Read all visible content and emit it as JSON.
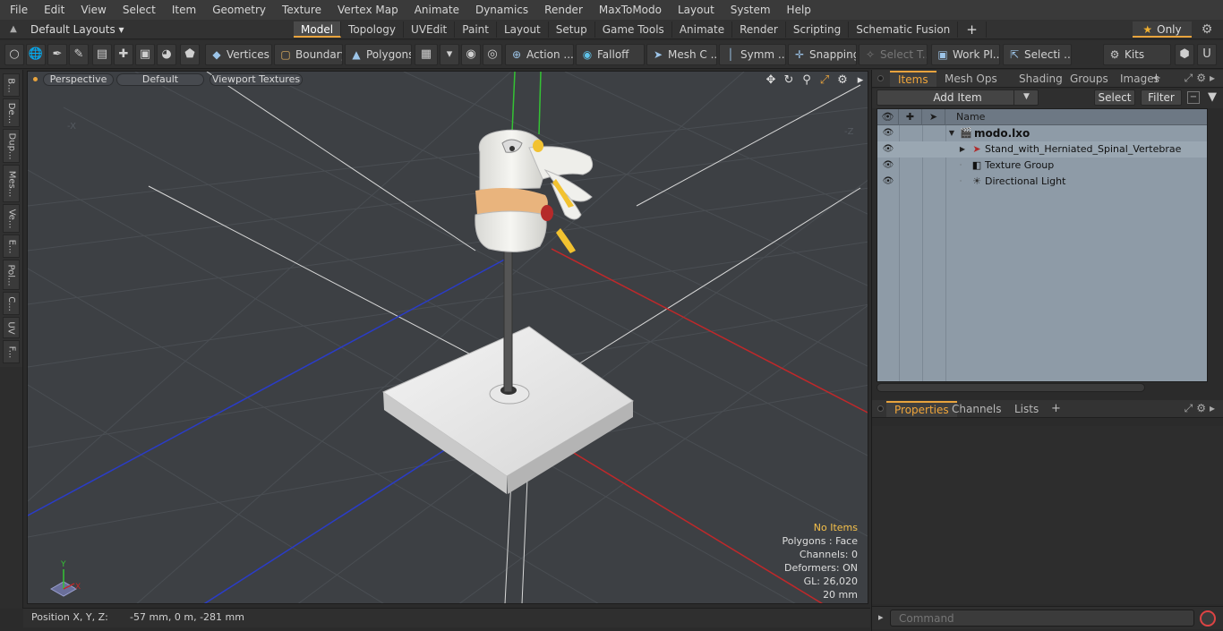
{
  "menu": [
    "File",
    "Edit",
    "View",
    "Select",
    "Item",
    "Geometry",
    "Texture",
    "Vertex Map",
    "Animate",
    "Dynamics",
    "Render",
    "MaxToModo",
    "Layout",
    "System",
    "Help"
  ],
  "layout": {
    "select_label": "Default Layouts",
    "tabs": [
      "Model",
      "Topology",
      "UVEdit",
      "Paint",
      "Layout",
      "Setup",
      "Game Tools",
      "Animate",
      "Render",
      "Scripting",
      "Schematic Fusion"
    ],
    "active_tab": "Model",
    "only_label": "Only"
  },
  "toolbar": {
    "vertices": "Vertices",
    "boundary": "Boundary",
    "polygons": "Polygons",
    "action": "Action ...",
    "falloff": "Falloff",
    "mesh": "Mesh C ...",
    "symm": "Symm ...",
    "snapping": "Snapping",
    "select_t": "Select T...",
    "work_pl": "Work Pl...",
    "selecti": "Selecti ...",
    "kits": "Kits"
  },
  "left_tabs": [
    "B...",
    "De...",
    "Dup...",
    "Mes...",
    "Ve...",
    "E...",
    "Pol...",
    "C...",
    "UV",
    "F..."
  ],
  "viewport": {
    "view_mode": "Perspective",
    "shading": "Default",
    "textures": "Viewport Textures",
    "info": {
      "selection": "No Items",
      "polygons": "Polygons : Face",
      "channels": "Channels: 0",
      "deformers": "Deformers: ON",
      "gl": "GL: 26,020",
      "scale": "20 mm"
    },
    "axis_labels": {
      "x": "X",
      "y": "Y",
      "neg_x": "-X",
      "neg_z": "-Z"
    }
  },
  "status": {
    "label": "Position X, Y, Z:",
    "value": "-57 mm, 0 m, -281 mm"
  },
  "items_panel": {
    "tabs": [
      "Items",
      "Mesh Ops",
      "Shading",
      "Groups",
      "Images"
    ],
    "active_tab": "Items",
    "add_item": "Add Item",
    "select": "Select",
    "filter": "Filter",
    "name_header": "Name",
    "rows": [
      {
        "label": "modo.lxo",
        "icon": "scene-icon"
      },
      {
        "label": "Stand_with_Herniated_Spinal_Vertebrae",
        "icon": "mesh-locator-icon"
      },
      {
        "label": "Texture Group",
        "icon": "texture-group-icon"
      },
      {
        "label": "Directional Light",
        "icon": "light-icon"
      }
    ]
  },
  "props_panel": {
    "tabs": [
      "Properties",
      "Channels",
      "Lists"
    ],
    "active_tab": "Properties"
  },
  "command": {
    "placeholder": "Command"
  },
  "colors": {
    "accent": "#e8a33d",
    "items_bg": "#8e9ba7",
    "viewport_bg": "#3d4044",
    "x_axis": "#c0282a",
    "z_axis": "#2a3cc8",
    "y_axis": "#34c234"
  }
}
